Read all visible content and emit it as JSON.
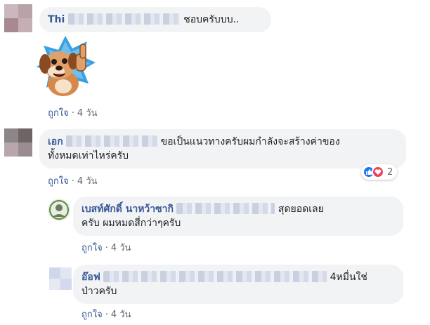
{
  "comments": [
    {
      "author": "Thi",
      "text": "ชอบครับบบ..",
      "like_label": "ถูกใจ",
      "time": "4 วัน",
      "sticker": "dog-thumbs-up-sticker"
    },
    {
      "author": "เอก",
      "text_line1": "ขอเป็นแนวทางครับผมกำลังจะสร้างค่าของ",
      "text_line2": "ทั้งหมดเท่าไหร่ครับ",
      "like_label": "ถูกใจ",
      "time": "4 วัน",
      "reactions": {
        "icons": [
          "like-icon",
          "love-icon"
        ],
        "count": "2"
      },
      "replies": [
        {
          "author": "เบสท์ศักดิ์ นาหว้าซากิ",
          "text_line1": "สุดยอดเลย",
          "text_line2": "ครับ ผมหมดสี่กว่าๆครับ",
          "like_label": "ถูกใจ",
          "time": "4 วัน"
        },
        {
          "author": "อ๊อฟ",
          "text_line1": "4หมื่นใช่",
          "text_line2": "ป่าวครับ",
          "like_label": "ถูกใจ",
          "time": "4 วัน"
        }
      ]
    }
  ],
  "colors": {
    "link": "#385898",
    "bubble": "#f2f3f5",
    "meta": "#606770",
    "like": "#1877f2",
    "love": "#f33e58"
  }
}
